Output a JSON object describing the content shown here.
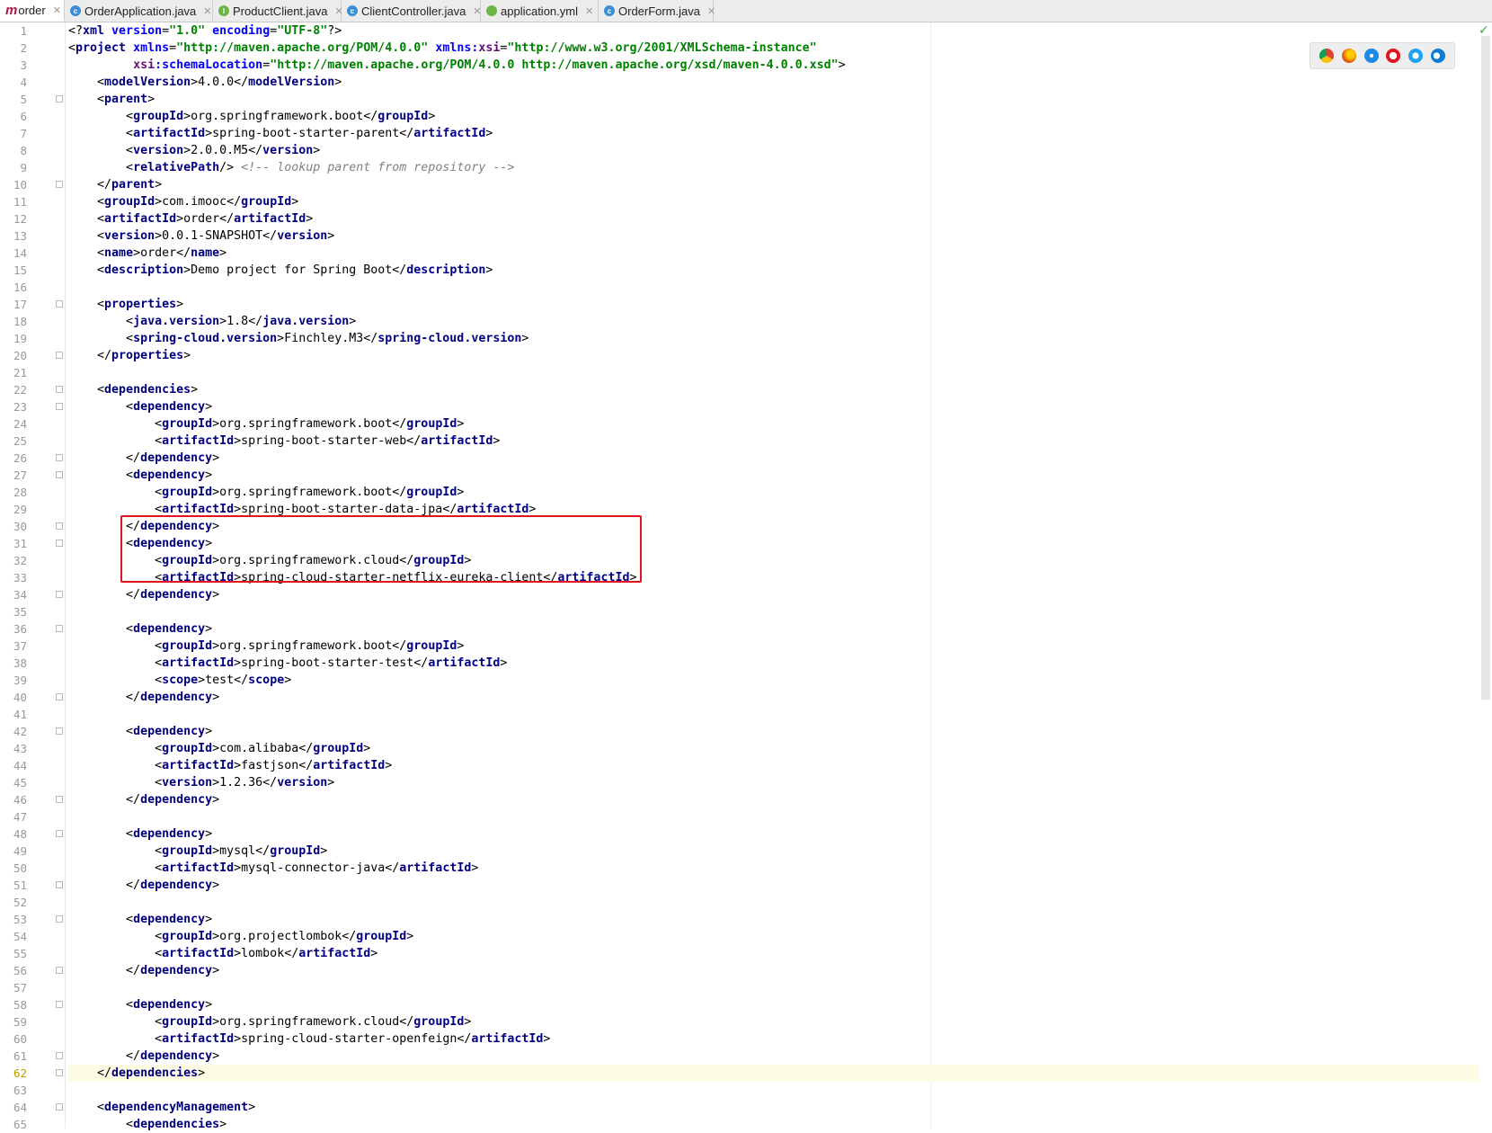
{
  "tabs": [
    {
      "label": "order",
      "icon": "maven-icon",
      "active": true
    },
    {
      "label": "OrderApplication.java",
      "icon": "java-class-icon",
      "color": "#3c8fd6"
    },
    {
      "label": "ProductClient.java",
      "icon": "java-interface-icon",
      "color": "#6cb649"
    },
    {
      "label": "ClientController.java",
      "icon": "java-class-icon",
      "color": "#3c8fd6"
    },
    {
      "label": "application.yml",
      "icon": "yaml-leaf-icon",
      "color": "#6cb649"
    },
    {
      "label": "OrderForm.java",
      "icon": "java-class-icon",
      "color": "#3c8fd6"
    }
  ],
  "browser_icons": [
    "chrome-icon",
    "firefox-icon",
    "safari-icon",
    "opera-icon",
    "ie-icon",
    "edge-icon"
  ],
  "current_line": 62,
  "colors": {
    "tag": "#000080",
    "attribute": "#0000ff",
    "string": "#008000",
    "comment": "#808080",
    "highlight": "#e0161f"
  },
  "lines": [
    {
      "n": 1,
      "indent": 0,
      "parts": [
        [
          "p",
          "<?"
        ],
        [
          "t",
          "xml "
        ],
        [
          "a",
          "version"
        ],
        [
          "p",
          "="
        ],
        [
          "s",
          "\"1.0\""
        ],
        [
          "p",
          " "
        ],
        [
          "a",
          "encoding"
        ],
        [
          "p",
          "="
        ],
        [
          "s",
          "\"UTF-8\""
        ],
        [
          "p",
          "?>"
        ]
      ]
    },
    {
      "n": 2,
      "indent": 0,
      "parts": [
        [
          "p",
          "<"
        ],
        [
          "t",
          "project "
        ],
        [
          "a",
          "xmlns"
        ],
        [
          "p",
          "="
        ],
        [
          "s",
          "\"http://maven.apache.org/POM/4.0.0\""
        ],
        [
          "p",
          " "
        ],
        [
          "a",
          "xmlns:"
        ],
        [
          "ns",
          "xsi"
        ],
        [
          "p",
          "="
        ],
        [
          "s",
          "\"http://www.w3.org/2001/XMLSchema-instance\""
        ]
      ]
    },
    {
      "n": 3,
      "indent": 0,
      "parts": [
        [
          "p",
          "         "
        ],
        [
          "ns",
          "xsi"
        ],
        [
          "a",
          ":schemaLocation"
        ],
        [
          "p",
          "="
        ],
        [
          "s",
          "\"http://maven.apache.org/POM/4.0.0 http://maven.apache.org/xsd/maven-4.0.0.xsd\""
        ],
        [
          "p",
          ">"
        ]
      ]
    },
    {
      "n": 4,
      "indent": 4,
      "parts": [
        [
          "p",
          "<"
        ],
        [
          "t",
          "modelVersion"
        ],
        [
          "p",
          ">4.0.0</"
        ],
        [
          "t",
          "modelVersion"
        ],
        [
          "p",
          ">"
        ]
      ]
    },
    {
      "n": 5,
      "indent": 4,
      "parts": [
        [
          "p",
          "<"
        ],
        [
          "t",
          "parent"
        ],
        [
          "p",
          ">"
        ]
      ]
    },
    {
      "n": 6,
      "indent": 8,
      "parts": [
        [
          "p",
          "<"
        ],
        [
          "t",
          "groupId"
        ],
        [
          "p",
          ">org.springframework.boot</"
        ],
        [
          "t",
          "groupId"
        ],
        [
          "p",
          ">"
        ]
      ]
    },
    {
      "n": 7,
      "indent": 8,
      "parts": [
        [
          "p",
          "<"
        ],
        [
          "t",
          "artifactId"
        ],
        [
          "p",
          ">spring-boot-starter-parent</"
        ],
        [
          "t",
          "artifactId"
        ],
        [
          "p",
          ">"
        ]
      ]
    },
    {
      "n": 8,
      "indent": 8,
      "parts": [
        [
          "p",
          "<"
        ],
        [
          "t",
          "version"
        ],
        [
          "p",
          ">2.0.0.M5</"
        ],
        [
          "t",
          "version"
        ],
        [
          "p",
          ">"
        ]
      ]
    },
    {
      "n": 9,
      "indent": 8,
      "parts": [
        [
          "p",
          "<"
        ],
        [
          "t",
          "relativePath"
        ],
        [
          "p",
          "/> "
        ],
        [
          "c",
          "<!-- lookup parent from repository -->"
        ]
      ]
    },
    {
      "n": 10,
      "indent": 4,
      "parts": [
        [
          "p",
          "</"
        ],
        [
          "t",
          "parent"
        ],
        [
          "p",
          ">"
        ]
      ]
    },
    {
      "n": 11,
      "indent": 4,
      "parts": [
        [
          "p",
          "<"
        ],
        [
          "t",
          "groupId"
        ],
        [
          "p",
          ">com.imooc</"
        ],
        [
          "t",
          "groupId"
        ],
        [
          "p",
          ">"
        ]
      ]
    },
    {
      "n": 12,
      "indent": 4,
      "parts": [
        [
          "p",
          "<"
        ],
        [
          "t",
          "artifactId"
        ],
        [
          "p",
          ">order</"
        ],
        [
          "t",
          "artifactId"
        ],
        [
          "p",
          ">"
        ]
      ]
    },
    {
      "n": 13,
      "indent": 4,
      "parts": [
        [
          "p",
          "<"
        ],
        [
          "t",
          "version"
        ],
        [
          "p",
          ">0.0.1-SNAPSHOT</"
        ],
        [
          "t",
          "version"
        ],
        [
          "p",
          ">"
        ]
      ]
    },
    {
      "n": 14,
      "indent": 4,
      "parts": [
        [
          "p",
          "<"
        ],
        [
          "t",
          "name"
        ],
        [
          "p",
          ">order</"
        ],
        [
          "t",
          "name"
        ],
        [
          "p",
          ">"
        ]
      ]
    },
    {
      "n": 15,
      "indent": 4,
      "parts": [
        [
          "p",
          "<"
        ],
        [
          "t",
          "description"
        ],
        [
          "p",
          ">Demo project for Spring Boot</"
        ],
        [
          "t",
          "description"
        ],
        [
          "p",
          ">"
        ]
      ]
    },
    {
      "n": 16,
      "indent": 0,
      "parts": []
    },
    {
      "n": 17,
      "indent": 4,
      "parts": [
        [
          "p",
          "<"
        ],
        [
          "t",
          "properties"
        ],
        [
          "p",
          ">"
        ]
      ]
    },
    {
      "n": 18,
      "indent": 8,
      "parts": [
        [
          "p",
          "<"
        ],
        [
          "t",
          "java.version"
        ],
        [
          "p",
          ">1.8</"
        ],
        [
          "t",
          "java.version"
        ],
        [
          "p",
          ">"
        ]
      ]
    },
    {
      "n": 19,
      "indent": 8,
      "parts": [
        [
          "p",
          "<"
        ],
        [
          "t",
          "spring-cloud.version"
        ],
        [
          "p",
          ">Finchley.M3</"
        ],
        [
          "t",
          "spring-cloud.version"
        ],
        [
          "p",
          ">"
        ]
      ]
    },
    {
      "n": 20,
      "indent": 4,
      "parts": [
        [
          "p",
          "</"
        ],
        [
          "t",
          "properties"
        ],
        [
          "p",
          ">"
        ]
      ]
    },
    {
      "n": 21,
      "indent": 0,
      "parts": []
    },
    {
      "n": 22,
      "indent": 4,
      "parts": [
        [
          "p",
          "<"
        ],
        [
          "t",
          "dependencies"
        ],
        [
          "p",
          ">"
        ]
      ]
    },
    {
      "n": 23,
      "indent": 8,
      "parts": [
        [
          "p",
          "<"
        ],
        [
          "t",
          "dependency"
        ],
        [
          "p",
          ">"
        ]
      ]
    },
    {
      "n": 24,
      "indent": 12,
      "parts": [
        [
          "p",
          "<"
        ],
        [
          "t",
          "groupId"
        ],
        [
          "p",
          ">org.springframework.boot</"
        ],
        [
          "t",
          "groupId"
        ],
        [
          "p",
          ">"
        ]
      ]
    },
    {
      "n": 25,
      "indent": 12,
      "parts": [
        [
          "p",
          "<"
        ],
        [
          "t",
          "artifactId"
        ],
        [
          "p",
          ">spring-boot-starter-web</"
        ],
        [
          "t",
          "artifactId"
        ],
        [
          "p",
          ">"
        ]
      ]
    },
    {
      "n": 26,
      "indent": 8,
      "parts": [
        [
          "p",
          "</"
        ],
        [
          "t",
          "dependency"
        ],
        [
          "p",
          ">"
        ]
      ]
    },
    {
      "n": 27,
      "indent": 8,
      "parts": [
        [
          "p",
          "<"
        ],
        [
          "t",
          "dependency"
        ],
        [
          "p",
          ">"
        ]
      ]
    },
    {
      "n": 28,
      "indent": 12,
      "parts": [
        [
          "p",
          "<"
        ],
        [
          "t",
          "groupId"
        ],
        [
          "p",
          ">org.springframework.boot</"
        ],
        [
          "t",
          "groupId"
        ],
        [
          "p",
          ">"
        ]
      ]
    },
    {
      "n": 29,
      "indent": 12,
      "parts": [
        [
          "p",
          "<"
        ],
        [
          "t",
          "artifactId"
        ],
        [
          "p",
          ">spring-boot-starter-data-jpa</"
        ],
        [
          "t",
          "artifactId"
        ],
        [
          "p",
          ">"
        ]
      ]
    },
    {
      "n": 30,
      "indent": 8,
      "parts": [
        [
          "p",
          "</"
        ],
        [
          "t",
          "dependency"
        ],
        [
          "p",
          ">"
        ]
      ]
    },
    {
      "n": 31,
      "indent": 8,
      "parts": [
        [
          "p",
          "<"
        ],
        [
          "t",
          "dependency"
        ],
        [
          "p",
          ">"
        ]
      ]
    },
    {
      "n": 32,
      "indent": 12,
      "parts": [
        [
          "p",
          "<"
        ],
        [
          "t",
          "groupId"
        ],
        [
          "p",
          ">org.springframework.cloud</"
        ],
        [
          "t",
          "groupId"
        ],
        [
          "p",
          ">"
        ]
      ]
    },
    {
      "n": 33,
      "indent": 12,
      "parts": [
        [
          "p",
          "<"
        ],
        [
          "t",
          "artifactId"
        ],
        [
          "p",
          ">spring-cloud-starter-netflix-eureka-client</"
        ],
        [
          "t",
          "artifactId"
        ],
        [
          "p",
          ">"
        ]
      ]
    },
    {
      "n": 34,
      "indent": 8,
      "parts": [
        [
          "p",
          "</"
        ],
        [
          "t",
          "dependency"
        ],
        [
          "p",
          ">"
        ]
      ]
    },
    {
      "n": 35,
      "indent": 0,
      "parts": []
    },
    {
      "n": 36,
      "indent": 8,
      "parts": [
        [
          "p",
          "<"
        ],
        [
          "t",
          "dependency"
        ],
        [
          "p",
          ">"
        ]
      ]
    },
    {
      "n": 37,
      "indent": 12,
      "parts": [
        [
          "p",
          "<"
        ],
        [
          "t",
          "groupId"
        ],
        [
          "p",
          ">org.springframework.boot</"
        ],
        [
          "t",
          "groupId"
        ],
        [
          "p",
          ">"
        ]
      ]
    },
    {
      "n": 38,
      "indent": 12,
      "parts": [
        [
          "p",
          "<"
        ],
        [
          "t",
          "artifactId"
        ],
        [
          "p",
          ">spring-boot-starter-test</"
        ],
        [
          "t",
          "artifactId"
        ],
        [
          "p",
          ">"
        ]
      ]
    },
    {
      "n": 39,
      "indent": 12,
      "parts": [
        [
          "p",
          "<"
        ],
        [
          "t",
          "scope"
        ],
        [
          "p",
          ">test</"
        ],
        [
          "t",
          "scope"
        ],
        [
          "p",
          ">"
        ]
      ]
    },
    {
      "n": 40,
      "indent": 8,
      "parts": [
        [
          "p",
          "</"
        ],
        [
          "t",
          "dependency"
        ],
        [
          "p",
          ">"
        ]
      ]
    },
    {
      "n": 41,
      "indent": 0,
      "parts": []
    },
    {
      "n": 42,
      "indent": 8,
      "parts": [
        [
          "p",
          "<"
        ],
        [
          "t",
          "dependency"
        ],
        [
          "p",
          ">"
        ]
      ]
    },
    {
      "n": 43,
      "indent": 12,
      "parts": [
        [
          "p",
          "<"
        ],
        [
          "t",
          "groupId"
        ],
        [
          "p",
          ">com.alibaba</"
        ],
        [
          "t",
          "groupId"
        ],
        [
          "p",
          ">"
        ]
      ]
    },
    {
      "n": 44,
      "indent": 12,
      "parts": [
        [
          "p",
          "<"
        ],
        [
          "t",
          "artifactId"
        ],
        [
          "p",
          ">fastjson</"
        ],
        [
          "t",
          "artifactId"
        ],
        [
          "p",
          ">"
        ]
      ]
    },
    {
      "n": 45,
      "indent": 12,
      "parts": [
        [
          "p",
          "<"
        ],
        [
          "t",
          "version"
        ],
        [
          "p",
          ">1.2.36</"
        ],
        [
          "t",
          "version"
        ],
        [
          "p",
          ">"
        ]
      ]
    },
    {
      "n": 46,
      "indent": 8,
      "parts": [
        [
          "p",
          "</"
        ],
        [
          "t",
          "dependency"
        ],
        [
          "p",
          ">"
        ]
      ]
    },
    {
      "n": 47,
      "indent": 0,
      "parts": []
    },
    {
      "n": 48,
      "indent": 8,
      "parts": [
        [
          "p",
          "<"
        ],
        [
          "t",
          "dependency"
        ],
        [
          "p",
          ">"
        ]
      ]
    },
    {
      "n": 49,
      "indent": 12,
      "parts": [
        [
          "p",
          "<"
        ],
        [
          "t",
          "groupId"
        ],
        [
          "p",
          ">mysql</"
        ],
        [
          "t",
          "groupId"
        ],
        [
          "p",
          ">"
        ]
      ]
    },
    {
      "n": 50,
      "indent": 12,
      "parts": [
        [
          "p",
          "<"
        ],
        [
          "t",
          "artifactId"
        ],
        [
          "p",
          ">mysql-connector-java</"
        ],
        [
          "t",
          "artifactId"
        ],
        [
          "p",
          ">"
        ]
      ]
    },
    {
      "n": 51,
      "indent": 8,
      "parts": [
        [
          "p",
          "</"
        ],
        [
          "t",
          "dependency"
        ],
        [
          "p",
          ">"
        ]
      ]
    },
    {
      "n": 52,
      "indent": 0,
      "parts": []
    },
    {
      "n": 53,
      "indent": 8,
      "parts": [
        [
          "p",
          "<"
        ],
        [
          "t",
          "dependency"
        ],
        [
          "p",
          ">"
        ]
      ]
    },
    {
      "n": 54,
      "indent": 12,
      "parts": [
        [
          "p",
          "<"
        ],
        [
          "t",
          "groupId"
        ],
        [
          "p",
          ">org.projectlombok</"
        ],
        [
          "t",
          "groupId"
        ],
        [
          "p",
          ">"
        ]
      ]
    },
    {
      "n": 55,
      "indent": 12,
      "parts": [
        [
          "p",
          "<"
        ],
        [
          "t",
          "artifactId"
        ],
        [
          "p",
          ">lombok</"
        ],
        [
          "t",
          "artifactId"
        ],
        [
          "p",
          ">"
        ]
      ]
    },
    {
      "n": 56,
      "indent": 8,
      "parts": [
        [
          "p",
          "</"
        ],
        [
          "t",
          "dependency"
        ],
        [
          "p",
          ">"
        ]
      ]
    },
    {
      "n": 57,
      "indent": 0,
      "parts": []
    },
    {
      "n": 58,
      "indent": 8,
      "parts": [
        [
          "p",
          "<"
        ],
        [
          "t",
          "dependency"
        ],
        [
          "p",
          ">"
        ]
      ]
    },
    {
      "n": 59,
      "indent": 12,
      "parts": [
        [
          "p",
          "<"
        ],
        [
          "t",
          "groupId"
        ],
        [
          "p",
          ">org.springframework.cloud</"
        ],
        [
          "t",
          "groupId"
        ],
        [
          "p",
          ">"
        ]
      ]
    },
    {
      "n": 60,
      "indent": 12,
      "parts": [
        [
          "p",
          "<"
        ],
        [
          "t",
          "artifactId"
        ],
        [
          "p",
          ">spring-cloud-starter-openfeign</"
        ],
        [
          "t",
          "artifactId"
        ],
        [
          "p",
          ">"
        ]
      ]
    },
    {
      "n": 61,
      "indent": 8,
      "parts": [
        [
          "p",
          "</"
        ],
        [
          "t",
          "dependency"
        ],
        [
          "p",
          ">"
        ]
      ]
    },
    {
      "n": 62,
      "indent": 4,
      "parts": [
        [
          "p",
          "</"
        ],
        [
          "t",
          "dependencies"
        ],
        [
          "p",
          ">"
        ]
      ]
    },
    {
      "n": 63,
      "indent": 0,
      "parts": []
    },
    {
      "n": 64,
      "indent": 4,
      "parts": [
        [
          "p",
          "<"
        ],
        [
          "t",
          "dependencyManagement"
        ],
        [
          "p",
          ">"
        ]
      ]
    },
    {
      "n": 65,
      "indent": 8,
      "parts": [
        [
          "p",
          "<"
        ],
        [
          "t",
          "dependencies"
        ],
        [
          "p",
          ">"
        ]
      ]
    }
  ],
  "fold_lines": [
    5,
    10,
    17,
    20,
    22,
    23,
    26,
    27,
    30,
    31,
    34,
    36,
    40,
    42,
    46,
    48,
    51,
    53,
    56,
    58,
    61,
    62,
    64
  ]
}
